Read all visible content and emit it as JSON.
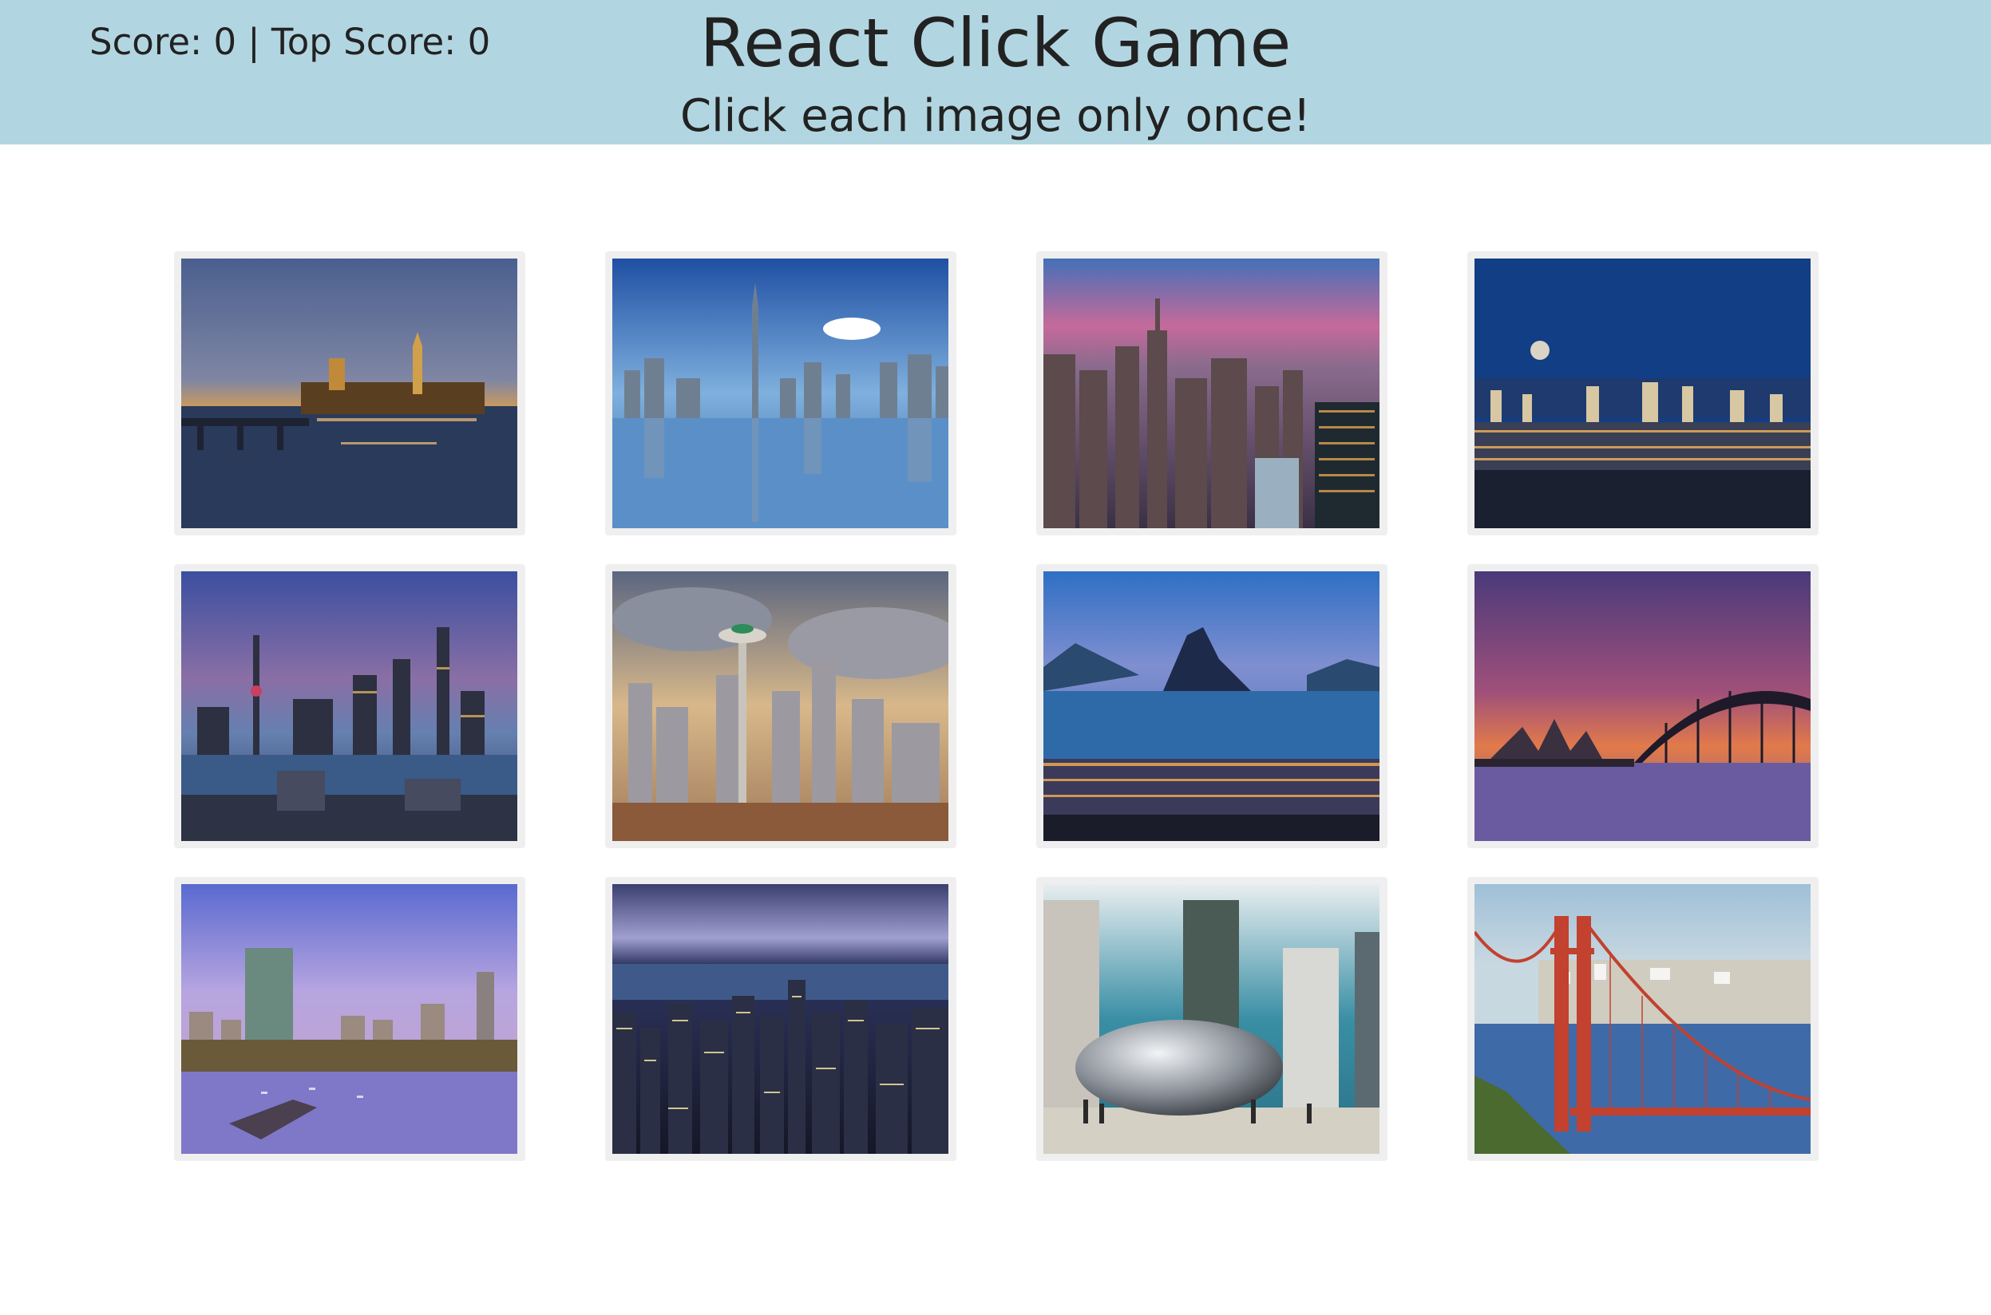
{
  "header": {
    "score_text": "Score: 0 | Top Score: 0",
    "title": "React Click Game",
    "subtitle": "Click each image only once!",
    "background_color": "#b2d6e1"
  },
  "game": {
    "score": 0,
    "top_score": 0,
    "cards": [
      {
        "id": "london",
        "depicts": "Westminster and Big Ben at dusk over the Thames"
      },
      {
        "id": "dubai",
        "depicts": "Dubai skyline with Burj Khalifa reflected in water"
      },
      {
        "id": "new-york",
        "depicts": "Manhattan skyline at sunset"
      },
      {
        "id": "las-vegas",
        "depicts": "Las Vegas strip at night under the moon"
      },
      {
        "id": "shanghai",
        "depicts": "Shanghai Pudong skyline over the river"
      },
      {
        "id": "seattle",
        "depicts": "Seattle Space Needle and skyline under clouds"
      },
      {
        "id": "rio",
        "depicts": "Rio de Janeiro with Sugarloaf Mountain"
      },
      {
        "id": "sydney",
        "depicts": "Sydney Opera House and Harbour Bridge at sunset"
      },
      {
        "id": "boston",
        "depicts": "Boston skyline over the river at dusk"
      },
      {
        "id": "hong-kong",
        "depicts": "Hong Kong skyline at night"
      },
      {
        "id": "chicago",
        "depicts": "Chicago Cloud Gate bean and skyscrapers"
      },
      {
        "id": "san-francisco",
        "depicts": "Golden Gate Bridge and San Francisco"
      }
    ]
  }
}
